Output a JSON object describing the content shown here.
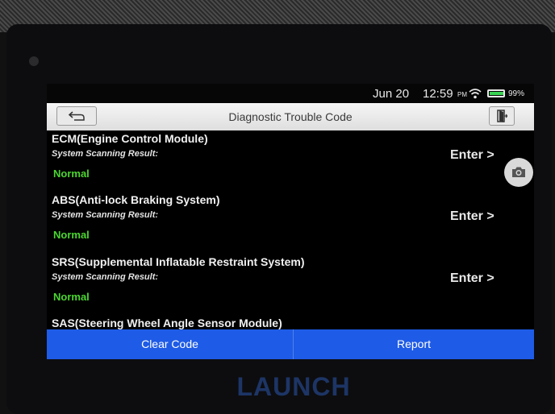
{
  "status_bar": {
    "date": "Jun 20",
    "time": "12:59",
    "ampm": "PM",
    "battery": "99%"
  },
  "header": {
    "title": "Diagnostic Trouble Code"
  },
  "systems": [
    {
      "name": "ECM(Engine Control Module)",
      "subtitle": "System Scanning Result:",
      "status": "Normal",
      "action": "Enter >"
    },
    {
      "name": "ABS(Anti-lock Braking System)",
      "subtitle": "System Scanning Result:",
      "status": "Normal",
      "action": "Enter >"
    },
    {
      "name": "SRS(Supplemental Inflatable Restraint System)",
      "subtitle": "System Scanning Result:",
      "status": "Normal",
      "action": "Enter >"
    },
    {
      "name": "SAS(Steering Wheel Angle Sensor Module)"
    }
  ],
  "footer": {
    "clear_label": "Clear Code",
    "report_label": "Report"
  },
  "brand": {
    "logo_text": "LAUNCH"
  },
  "colors": {
    "accent": "#1e5be6",
    "status_normal": "#4bd630",
    "battery": "#39d353"
  },
  "icons": {
    "back": "back-arrow-icon",
    "exit": "exit-icon",
    "camera": "camera-icon",
    "wifi": "wifi-icon",
    "battery": "battery-icon"
  }
}
